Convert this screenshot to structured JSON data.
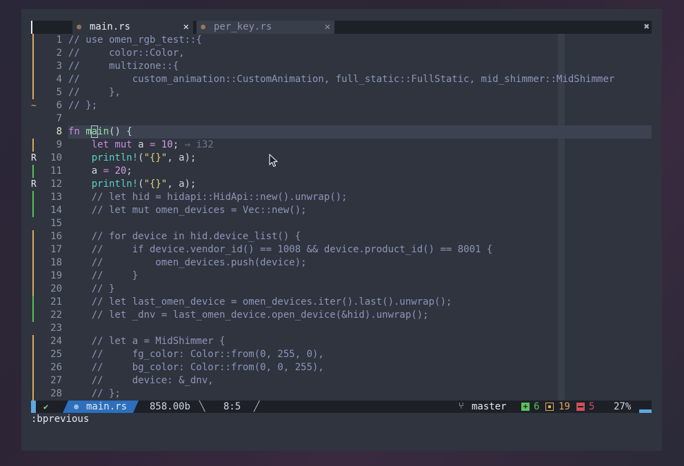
{
  "tabs": [
    {
      "icon": "⊛",
      "name": "main.rs",
      "close": "✕"
    },
    {
      "icon": "⊛",
      "name": "per_key.rs",
      "close": "✕"
    }
  ],
  "close_all": "✖",
  "lines": [
    {
      "num": "1",
      "sign": "mod",
      "tokens": [
        [
          "c-comment",
          "// use omen_rgb_test::{"
        ]
      ]
    },
    {
      "num": "2",
      "sign": "mod",
      "tokens": [
        [
          "c-comment",
          "//     color::Color,"
        ]
      ]
    },
    {
      "num": "3",
      "sign": "mod",
      "tokens": [
        [
          "c-comment",
          "//     multizone::{"
        ]
      ]
    },
    {
      "num": "4",
      "sign": "mod",
      "tokens": [
        [
          "c-comment",
          "//         custom_animation::CustomAnimation, full_static::FullStatic, mid_shimmer::MidShimmer"
        ]
      ]
    },
    {
      "num": "5",
      "sign": "mod",
      "tokens": [
        [
          "c-comment",
          "//     },"
        ]
      ]
    },
    {
      "num": "6",
      "sign": "tilde",
      "tokens": [
        [
          "c-comment",
          "// };"
        ]
      ]
    },
    {
      "num": "7",
      "sign": "",
      "tokens": []
    },
    {
      "num": "8",
      "sign": "",
      "current": true,
      "tokens": [
        [
          "c-kw",
          "fn "
        ],
        [
          "c-fnname",
          "m"
        ],
        [
          "c-cursor c-fnname",
          "a"
        ],
        [
          "c-fnname",
          "in"
        ],
        [
          "c-plain",
          "() {"
        ]
      ]
    },
    {
      "num": "9",
      "sign": "mod",
      "tokens": [
        [
          "c-plain",
          "    "
        ],
        [
          "c-kw",
          "let mut "
        ],
        [
          "c-plain",
          "a "
        ],
        [
          "c-op",
          "= "
        ],
        [
          "c-num",
          "10"
        ],
        [
          "c-plain",
          "; "
        ],
        [
          "c-hint",
          "⇒ i32"
        ]
      ]
    },
    {
      "num": "10",
      "sign": "r",
      "tokens": [
        [
          "c-plain",
          "    "
        ],
        [
          "c-macro",
          "println!"
        ],
        [
          "c-plain",
          "("
        ],
        [
          "c-str",
          "\"{}\""
        ],
        [
          "c-plain",
          ", a);"
        ]
      ]
    },
    {
      "num": "11",
      "sign": "add",
      "tokens": [
        [
          "c-plain",
          "    a "
        ],
        [
          "c-op",
          "= "
        ],
        [
          "c-num",
          "20"
        ],
        [
          "c-plain",
          ";"
        ]
      ]
    },
    {
      "num": "12",
      "sign": "r",
      "tokens": [
        [
          "c-plain",
          "    "
        ],
        [
          "c-macro",
          "println!"
        ],
        [
          "c-plain",
          "("
        ],
        [
          "c-str",
          "\"{}\""
        ],
        [
          "c-plain",
          ", a);"
        ]
      ]
    },
    {
      "num": "13",
      "sign": "add",
      "tokens": [
        [
          "c-comment",
          "    // let hid = hidapi::HidApi::new().unwrap();"
        ]
      ]
    },
    {
      "num": "14",
      "sign": "add",
      "tokens": [
        [
          "c-comment",
          "    // let mut omen_devices = Vec::new();"
        ]
      ]
    },
    {
      "num": "15",
      "sign": "",
      "tokens": []
    },
    {
      "num": "16",
      "sign": "mod",
      "tokens": [
        [
          "c-comment",
          "    // for device in hid.device_list() {"
        ]
      ]
    },
    {
      "num": "17",
      "sign": "mod",
      "tokens": [
        [
          "c-comment",
          "    //     if device.vendor_id() == 1008 && device.product_id() == 8001 {"
        ]
      ]
    },
    {
      "num": "18",
      "sign": "mod",
      "tokens": [
        [
          "c-comment",
          "    //         omen_devices.push(device);"
        ]
      ]
    },
    {
      "num": "19",
      "sign": "mod",
      "tokens": [
        [
          "c-comment",
          "    //     }"
        ]
      ]
    },
    {
      "num": "20",
      "sign": "mod",
      "tokens": [
        [
          "c-comment",
          "    // }"
        ]
      ]
    },
    {
      "num": "21",
      "sign": "add",
      "tokens": [
        [
          "c-comment",
          "    // let last_omen_device = omen_devices.iter().last().unwrap();"
        ]
      ]
    },
    {
      "num": "22",
      "sign": "add",
      "tokens": [
        [
          "c-comment",
          "    // let _dnv = last_omen_device.open_device(&hid).unwrap();"
        ]
      ]
    },
    {
      "num": "23",
      "sign": "",
      "tokens": []
    },
    {
      "num": "24",
      "sign": "mod",
      "tokens": [
        [
          "c-comment",
          "    // let a = MidShimmer {"
        ]
      ]
    },
    {
      "num": "25",
      "sign": "mod",
      "tokens": [
        [
          "c-comment",
          "    //     fg_color: Color::from(0, 255, 0),"
        ]
      ]
    },
    {
      "num": "26",
      "sign": "mod",
      "tokens": [
        [
          "c-comment",
          "    //     bg_color: Color::from(0, 0, 255),"
        ]
      ]
    },
    {
      "num": "27",
      "sign": "mod",
      "tokens": [
        [
          "c-comment",
          "    //     device: &_dnv,"
        ]
      ]
    },
    {
      "num": "28",
      "sign": "mod",
      "tokens": [
        [
          "c-comment",
          "    // };"
        ]
      ]
    }
  ],
  "sign_chars": {
    "tilde": "~",
    "r": "R"
  },
  "status": {
    "mode_icon": "✔",
    "file_icon": "⊛",
    "filename": "main.rs",
    "size": "858.00b",
    "sep1": "╲",
    "position": "8:5",
    "sep2": "╱",
    "branch_icon": "⑂",
    "branch": "master",
    "added": "6",
    "modified": "19",
    "removed": "5",
    "percent": "27%"
  },
  "cmdline": ":bprevious",
  "colors": {
    "window_bg": "#2f343f",
    "tabline_bg": "#1d2027",
    "accent_blue": "#2d6fbd",
    "git_add": "#5ac05a",
    "git_mod": "#e0a85a",
    "git_del": "#d0505a"
  }
}
